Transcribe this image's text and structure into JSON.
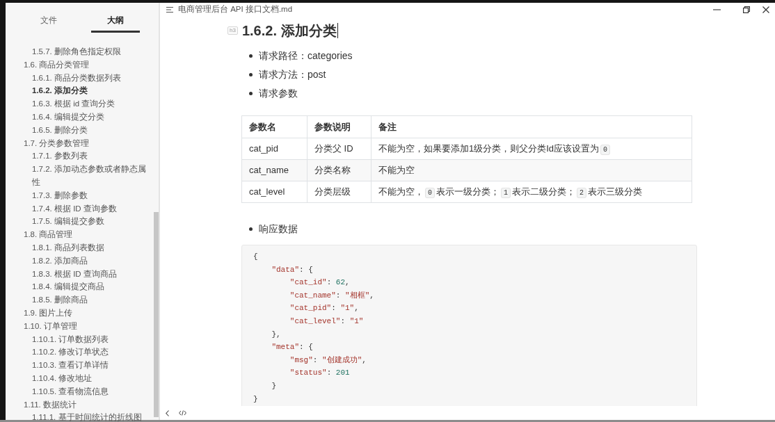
{
  "window": {
    "title": "电商管理后台 API 接口文档.md"
  },
  "sidebar": {
    "tabs": [
      {
        "label": "文件",
        "selected": false
      },
      {
        "label": "大纲",
        "selected": true
      }
    ],
    "outline": [
      {
        "children": [
          {
            "label": "1.5.7. 删除角色指定权限",
            "selected": false
          }
        ]
      },
      {
        "label": "1.6. 商品分类管理",
        "selected": false,
        "children": [
          {
            "label": "1.6.1. 商品分类数据列表",
            "selected": false
          },
          {
            "label": "1.6.2. 添加分类",
            "selected": true
          },
          {
            "label": "1.6.3. 根据 id 查询分类",
            "selected": false
          },
          {
            "label": "1.6.4. 编辑提交分类",
            "selected": false
          },
          {
            "label": "1.6.5. 删除分类",
            "selected": false
          }
        ]
      },
      {
        "label": "1.7. 分类参数管理",
        "selected": false,
        "children": [
          {
            "label": "1.7.1. 参数列表",
            "selected": false
          },
          {
            "label": "1.7.2. 添加动态参数或者静态属性",
            "selected": false
          },
          {
            "label": "1.7.3. 删除参数",
            "selected": false
          },
          {
            "label": "1.7.4. 根据 ID 查询参数",
            "selected": false
          },
          {
            "label": "1.7.5. 编辑提交参数",
            "selected": false
          }
        ]
      },
      {
        "label": "1.8. 商品管理",
        "selected": false,
        "children": [
          {
            "label": "1.8.1. 商品列表数据",
            "selected": false
          },
          {
            "label": "1.8.2. 添加商品",
            "selected": false
          },
          {
            "label": "1.8.3. 根据 ID 查询商品",
            "selected": false
          },
          {
            "label": "1.8.4. 编辑提交商品",
            "selected": false
          },
          {
            "label": "1.8.5. 删除商品",
            "selected": false
          }
        ]
      },
      {
        "label": "1.9. 图片上传",
        "selected": false
      },
      {
        "label": "1.10. 订单管理",
        "selected": false,
        "children": [
          {
            "label": "1.10.1. 订单数据列表",
            "selected": false
          },
          {
            "label": "1.10.2. 修改订单状态",
            "selected": false
          },
          {
            "label": "1.10.3. 查看订单详情",
            "selected": false
          },
          {
            "label": "1.10.4. 修改地址",
            "selected": false
          },
          {
            "label": "1.10.5. 查看物流信息",
            "selected": false
          }
        ]
      },
      {
        "label": "1.11. 数据统计",
        "selected": false,
        "children": [
          {
            "label": "1.11.1. 基于时间统计的折线图",
            "selected": false
          }
        ]
      }
    ]
  },
  "document": {
    "heading_marker": "h3",
    "heading": "1.6.2. 添加分类",
    "request_items": [
      "请求路径：categories",
      "请求方法：post",
      "请求参数"
    ],
    "params_table": {
      "columns": [
        "参数名",
        "参数说明",
        "备注"
      ],
      "rows": [
        {
          "name": "cat_pid",
          "description": "分类父 ID",
          "note": [
            {
              "kind": "text",
              "text": "不能为空，如果要添加1级分类，则父分类Id应该设置为"
            },
            {
              "kind": "code",
              "text": "0"
            }
          ]
        },
        {
          "name": "cat_name",
          "description": "分类名称",
          "note": [
            {
              "kind": "text",
              "text": "不能为空"
            }
          ]
        },
        {
          "name": "cat_level",
          "description": "分类层级",
          "note": [
            {
              "kind": "text",
              "text": "不能为空，"
            },
            {
              "kind": "code",
              "text": "0"
            },
            {
              "kind": "text",
              "text": "表示一级分类；"
            },
            {
              "kind": "code",
              "text": "1"
            },
            {
              "kind": "text",
              "text": "表示二级分类；"
            },
            {
              "kind": "code",
              "text": "2"
            },
            {
              "kind": "text",
              "text": "表示三级分类"
            }
          ]
        }
      ]
    },
    "response_items": [
      "响应数据"
    ],
    "code_lines": [
      [
        {
          "kind": "punct",
          "text": "{"
        }
      ],
      [
        {
          "kind": "string",
          "text": "    \"data\""
        },
        {
          "kind": "punct",
          "text": ": {"
        }
      ],
      [
        {
          "kind": "string",
          "text": "        \"cat_id\""
        },
        {
          "kind": "punct",
          "text": ": "
        },
        {
          "kind": "number",
          "text": "62"
        },
        {
          "kind": "punct",
          "text": ","
        }
      ],
      [
        {
          "kind": "string",
          "text": "        \"cat_name\""
        },
        {
          "kind": "punct",
          "text": ": "
        },
        {
          "kind": "string",
          "text": "\"相框\""
        },
        {
          "kind": "punct",
          "text": ","
        }
      ],
      [
        {
          "kind": "string",
          "text": "        \"cat_pid\""
        },
        {
          "kind": "punct",
          "text": ": "
        },
        {
          "kind": "string",
          "text": "\"1\""
        },
        {
          "kind": "punct",
          "text": ","
        }
      ],
      [
        {
          "kind": "string",
          "text": "        \"cat_level\""
        },
        {
          "kind": "punct",
          "text": ": "
        },
        {
          "kind": "string",
          "text": "\"1\""
        }
      ],
      [
        {
          "kind": "punct",
          "text": "    },"
        }
      ],
      [
        {
          "kind": "string",
          "text": "    \"meta\""
        },
        {
          "kind": "punct",
          "text": ": {"
        }
      ],
      [
        {
          "kind": "string",
          "text": "        \"msg\""
        },
        {
          "kind": "punct",
          "text": ": "
        },
        {
          "kind": "string",
          "text": "\"创建成功\""
        },
        {
          "kind": "punct",
          "text": ","
        }
      ],
      [
        {
          "kind": "string",
          "text": "        \"status\""
        },
        {
          "kind": "punct",
          "text": ": "
        },
        {
          "kind": "number",
          "text": "201"
        }
      ],
      [
        {
          "kind": "punct",
          "text": "    }"
        }
      ],
      [
        {
          "kind": "punct",
          "text": "}"
        }
      ]
    ]
  }
}
